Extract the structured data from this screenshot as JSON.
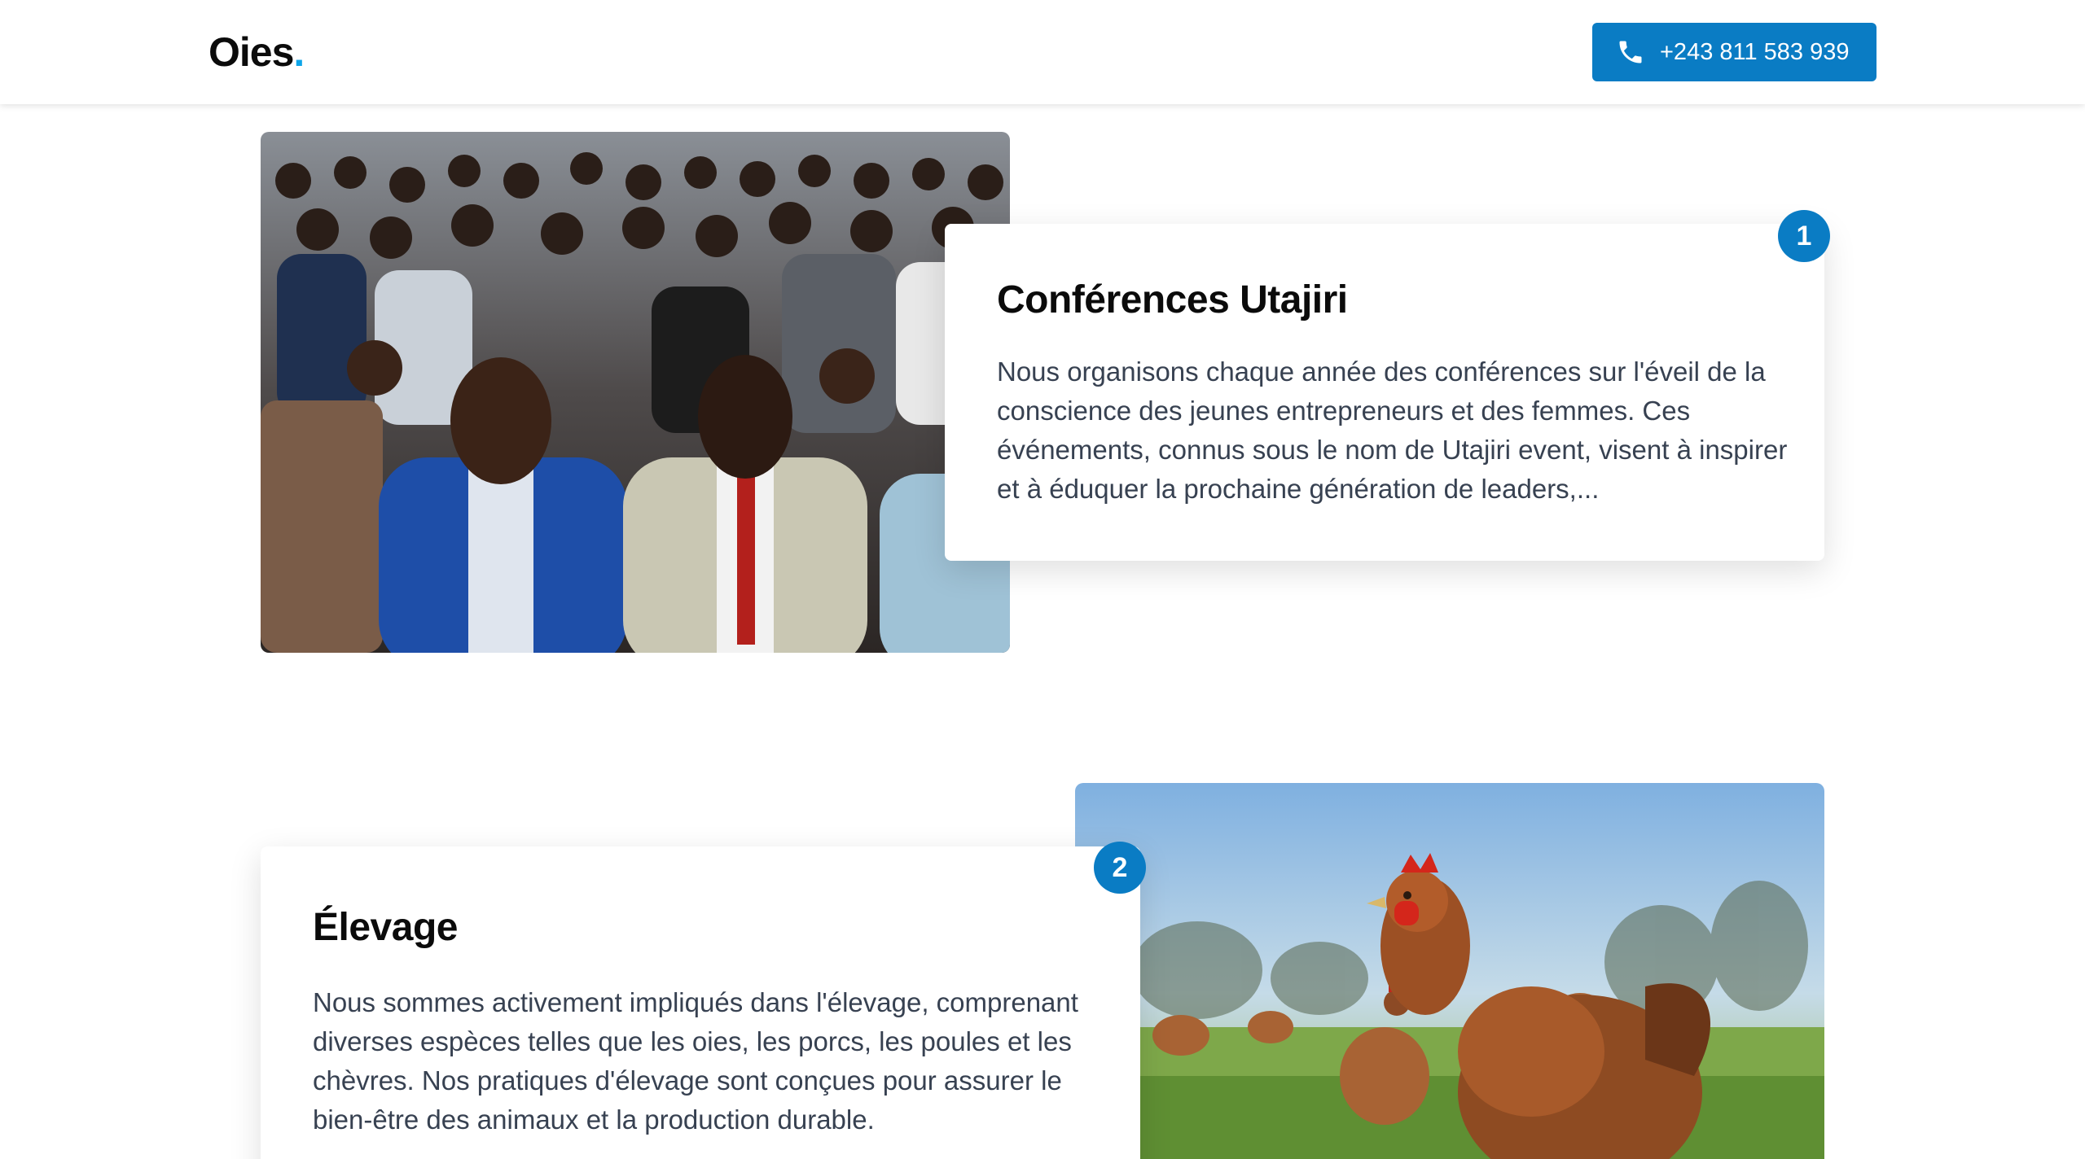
{
  "header": {
    "logo_text": "Oies",
    "logo_dot": ".",
    "phone_label": "+243 811 583 939",
    "phone_icon": "phone-icon",
    "accent_color": "#0a7cc4"
  },
  "sections": [
    {
      "number": "1",
      "title": "Conférences Utajiri",
      "text": "Nous organisons chaque année des conférences sur l'éveil de la conscience des jeunes entrepreneurs et des femmes. Ces événements, connus sous le nom de Utajiri event, visent à inspirer et à éduquer la prochaine génération de leaders,...",
      "image": "conference-audience-photo"
    },
    {
      "number": "2",
      "title": "Élevage",
      "text": "Nous sommes activement impliqués dans l'élevage, comprenant diverses espèces telles que les oies, les porcs, les poules et les chèvres. Nos pratiques d'élevage sont conçues pour assurer le bien-être des animaux et la production durable.",
      "image": "chickens-field-photo"
    }
  ]
}
